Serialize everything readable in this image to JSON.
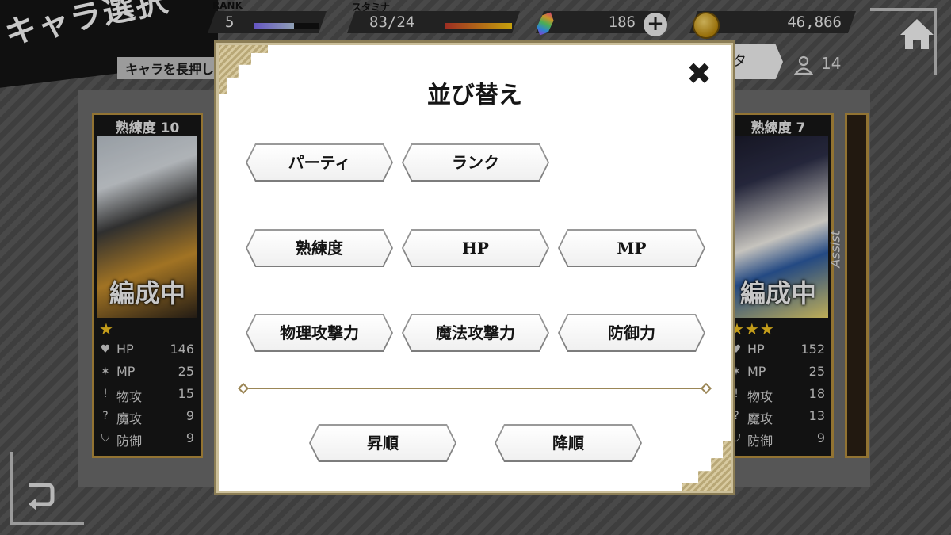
{
  "header": {
    "title": "キャラ選択",
    "hint": "キャラを長押し"
  },
  "stats": {
    "rank_caption": "RANK",
    "rank_value": "5",
    "rank_progress": 0.62,
    "stamina_caption": "スタミナ",
    "stamina_value": "83/24",
    "stamina_progress": 1.0,
    "gems_value": "186",
    "gold_value": "46,866"
  },
  "toolbar": {
    "sort_chip_fragment": "タ",
    "member_count": "14"
  },
  "cards": [
    {
      "mastery": "熟練度 10",
      "status": "編成中",
      "stars": "★",
      "stats": [
        {
          "icon": "heart-icon",
          "label": "HP",
          "value": "146"
        },
        {
          "icon": "mp-icon",
          "label": "MP",
          "value": "25"
        },
        {
          "icon": "sword-icon",
          "label": "物攻",
          "value": "15"
        },
        {
          "icon": "magic-icon",
          "label": "魔攻",
          "value": "9"
        },
        {
          "icon": "shield-icon",
          "label": "防御",
          "value": "9"
        }
      ]
    },
    {
      "mastery": "熟練度 7",
      "status": "編成中",
      "stars": "★★★",
      "assist": "Assist",
      "stats": [
        {
          "icon": "heart-icon",
          "label": "HP",
          "value": "152"
        },
        {
          "icon": "mp-icon",
          "label": "MP",
          "value": "25"
        },
        {
          "icon": "sword-icon",
          "label": "物攻",
          "value": "18"
        },
        {
          "icon": "magic-icon",
          "label": "魔攻",
          "value": "13"
        },
        {
          "icon": "shield-icon",
          "label": "防御",
          "value": "9"
        }
      ]
    }
  ],
  "sort_dialog": {
    "title": "並び替え",
    "close_glyph": "✖",
    "options": {
      "party": "パーティ",
      "rank": "ランク",
      "mastery": "熟練度",
      "hp": "HP",
      "mp": "MP",
      "phys_atk": "物理攻撃力",
      "mag_atk": "魔法攻撃力",
      "defense": "防御力"
    },
    "order": {
      "ascending": "昇順",
      "descending": "降順"
    }
  }
}
